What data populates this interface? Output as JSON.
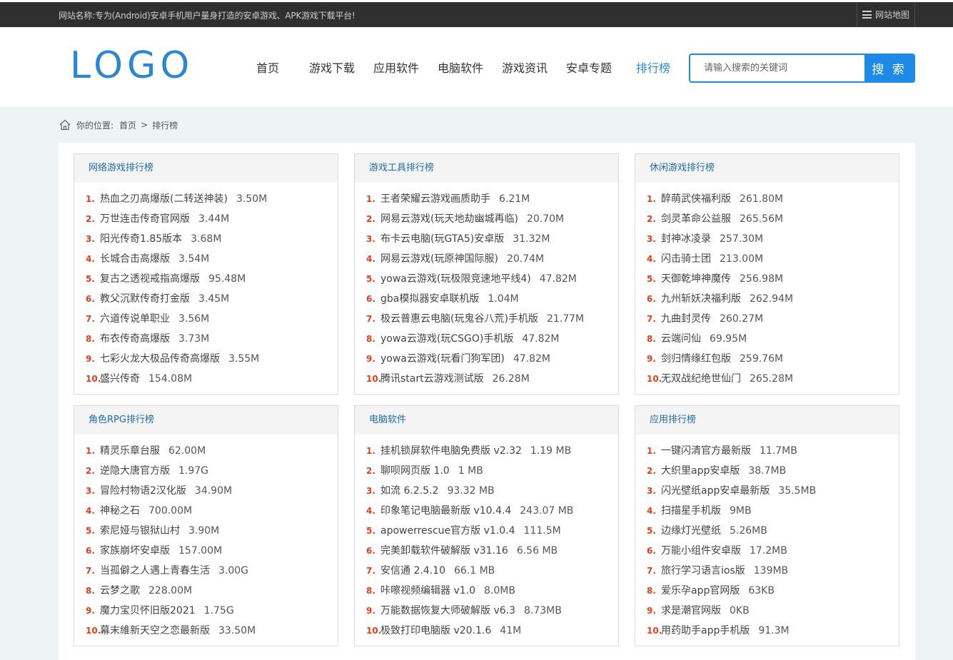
{
  "topbar": {
    "slogan": "网站名称:专为(Android)安卓手机用户量身打造的安卓游戏、APK游戏下载平台!",
    "sitemap_label": "网站地图"
  },
  "header": {
    "logo_text": "LOGO",
    "nav": [
      "首页",
      "游戏下载",
      "应用软件",
      "电脑软件",
      "游戏资讯",
      "安卓专题",
      "排行榜"
    ],
    "active_nav": "排行榜",
    "search_placeholder": "请输入搜索的关键词",
    "search_button": "搜 索"
  },
  "breadcrumb": {
    "prefix": "你的位置:",
    "home": "首页",
    "separator": ">",
    "current": "排行榜"
  },
  "colors": {
    "accent": "#1c8ae6",
    "rank_number": "#e2401b",
    "panel_title": "#1f6ca8"
  },
  "panels": [
    {
      "title": "网络游戏排行榜",
      "items": [
        {
          "n": "1.",
          "name": "热血之刃高爆版(二转送神装)",
          "size": "3.50M"
        },
        {
          "n": "2.",
          "name": "万世连击传奇官网版",
          "size": "3.44M"
        },
        {
          "n": "3.",
          "name": "阳光传奇1.85版本",
          "size": "3.68M"
        },
        {
          "n": "4.",
          "name": "长城合击高爆版",
          "size": "3.54M"
        },
        {
          "n": "5.",
          "name": "复古之透视戒指高爆版",
          "size": "95.48M"
        },
        {
          "n": "6.",
          "name": "教父沉默传奇打金版",
          "size": "3.45M"
        },
        {
          "n": "7.",
          "name": "六道传说单职业",
          "size": "3.56M"
        },
        {
          "n": "8.",
          "name": "布衣传奇高爆版",
          "size": "3.73M"
        },
        {
          "n": "9.",
          "name": "七彩火龙大极品传奇高爆版",
          "size": "3.55M"
        },
        {
          "n": "10.",
          "name": "盛兴传奇",
          "size": "154.08M"
        }
      ]
    },
    {
      "title": "游戏工具排行榜",
      "items": [
        {
          "n": "1.",
          "name": "王者荣耀云游戏画质助手",
          "size": "6.21M"
        },
        {
          "n": "2.",
          "name": "网易云游戏(玩天地劫幽城再临)",
          "size": "20.70M"
        },
        {
          "n": "3.",
          "name": "布卡云电脑(玩GTA5)安卓版",
          "size": "31.32M"
        },
        {
          "n": "4.",
          "name": "网易云游戏(玩原神国际服)",
          "size": "20.74M"
        },
        {
          "n": "5.",
          "name": "yowa云游戏(玩极限竞速地平线4)",
          "size": "47.82M"
        },
        {
          "n": "6.",
          "name": "gba模拟器安卓联机版",
          "size": "1.04M"
        },
        {
          "n": "7.",
          "name": "极云普惠云电脑(玩鬼谷八荒)手机版",
          "size": "21.77M"
        },
        {
          "n": "8.",
          "name": "yowa云游戏(玩CSGO)手机版",
          "size": "47.82M"
        },
        {
          "n": "9.",
          "name": "yowa云游戏(玩看门狗军团)",
          "size": "47.82M"
        },
        {
          "n": "10.",
          "name": "腾讯start云游戏测试版",
          "size": "26.28M"
        }
      ]
    },
    {
      "title": "休闲游戏排行榜",
      "items": [
        {
          "n": "1.",
          "name": "醉萌武侠福利版",
          "size": "261.80M"
        },
        {
          "n": "2.",
          "name": "剑灵革命公益服",
          "size": "265.56M"
        },
        {
          "n": "3.",
          "name": "封神冰凌录",
          "size": "257.30M"
        },
        {
          "n": "4.",
          "name": "闪击骑士团",
          "size": "213.00M"
        },
        {
          "n": "5.",
          "name": "天御乾坤神魔传",
          "size": "256.98M"
        },
        {
          "n": "6.",
          "name": "九州斩妖决福利版",
          "size": "262.94M"
        },
        {
          "n": "7.",
          "name": "九曲封灵传",
          "size": "260.27M"
        },
        {
          "n": "8.",
          "name": "云端问仙",
          "size": "69.95M"
        },
        {
          "n": "9.",
          "name": "剑归情缘红包版",
          "size": "259.76M"
        },
        {
          "n": "10.",
          "name": "无双战纪绝世仙门",
          "size": "265.28M"
        }
      ]
    },
    {
      "title": "角色RPG排行榜",
      "items": [
        {
          "n": "1.",
          "name": "精灵乐章台服",
          "size": "62.00M"
        },
        {
          "n": "2.",
          "name": "逆隐大唐官方版",
          "size": "1.97G"
        },
        {
          "n": "3.",
          "name": "冒险村物语2汉化版",
          "size": "34.90M"
        },
        {
          "n": "4.",
          "name": "神秘之石",
          "size": "700.00M"
        },
        {
          "n": "5.",
          "name": "索尼娅与银狱山村",
          "size": "3.90M"
        },
        {
          "n": "6.",
          "name": "家族崩坏安卓版",
          "size": "157.00M"
        },
        {
          "n": "7.",
          "name": "当孤僻之人遇上青春生活",
          "size": "3.00G"
        },
        {
          "n": "8.",
          "name": "云梦之歌",
          "size": "228.00M"
        },
        {
          "n": "9.",
          "name": "魔力宝贝怀旧版2021",
          "size": "1.75G"
        },
        {
          "n": "10.",
          "name": "幕末維新天空之恋最新版",
          "size": "33.50M"
        }
      ]
    },
    {
      "title": "电脑软件",
      "items": [
        {
          "n": "1.",
          "name": "挂机锁屏软件电脑免费版 v2.32",
          "size": "1.19 MB"
        },
        {
          "n": "2.",
          "name": "聊呗网页版 1.0",
          "size": "1 MB"
        },
        {
          "n": "3.",
          "name": "如流 6.2.5.2",
          "size": "93.32 MB"
        },
        {
          "n": "4.",
          "name": "印象笔记电脑最新版 v10.4.4",
          "size": "243.07 MB"
        },
        {
          "n": "5.",
          "name": "apowerrescue官方版 v1.0.4",
          "size": "111.5M"
        },
        {
          "n": "6.",
          "name": "完美卸载软件破解版 v31.16",
          "size": "6.56 MB"
        },
        {
          "n": "7.",
          "name": "安信通 2.4.10",
          "size": "66.1 MB"
        },
        {
          "n": "8.",
          "name": "咔嚓视频编辑器 v1.0",
          "size": "8.0MB"
        },
        {
          "n": "9.",
          "name": "万能数据恢复大师破解版 v6.3",
          "size": "8.73MB"
        },
        {
          "n": "10.",
          "name": "极致打印电脑版 v20.1.6",
          "size": "41M"
        }
      ]
    },
    {
      "title": "应用排行榜",
      "items": [
        {
          "n": "1.",
          "name": "一键闪清官方最新版",
          "size": "11.7MB"
        },
        {
          "n": "2.",
          "name": "大织里app安卓版",
          "size": "38.7MB"
        },
        {
          "n": "3.",
          "name": "闪光壁纸app安卓最新版",
          "size": "35.5MB"
        },
        {
          "n": "4.",
          "name": "扫描星手机版",
          "size": "9MB"
        },
        {
          "n": "5.",
          "name": "边缘灯光壁纸",
          "size": "5.26MB"
        },
        {
          "n": "6.",
          "name": "万能小组件安卓版",
          "size": "17.2MB"
        },
        {
          "n": "7.",
          "name": "旅行学习语言ios版",
          "size": "139MB"
        },
        {
          "n": "8.",
          "name": "爱乐孕app官网版",
          "size": "63KB"
        },
        {
          "n": "9.",
          "name": "求是潮官网版",
          "size": "0KB"
        },
        {
          "n": "10.",
          "name": "用药助手app手机版",
          "size": "91.3M"
        }
      ]
    }
  ]
}
